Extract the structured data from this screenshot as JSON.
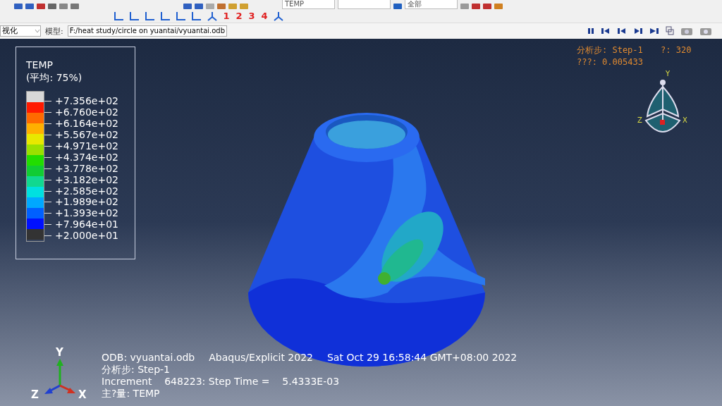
{
  "toolbar_top": {
    "fields": [
      "TEMP",
      "全部"
    ]
  },
  "view_toolbar": {
    "numbers": [
      "1",
      "2",
      "3",
      "4"
    ]
  },
  "context_bar": {
    "module": "视化",
    "model_label": "模型:",
    "model_path": "F:/heat study/circle on yuantai/vyuantai.odb"
  },
  "legend": {
    "title": "TEMP",
    "subtitle": "(平均: 75%)",
    "bands": [
      {
        "color": "#d8d8d8"
      },
      {
        "color": "#ff1a00"
      },
      {
        "color": "#ff6a00"
      },
      {
        "color": "#ffb000"
      },
      {
        "color": "#e8e800"
      },
      {
        "color": "#9ae000"
      },
      {
        "color": "#22dd00"
      },
      {
        "color": "#11cc33"
      },
      {
        "color": "#11d890"
      },
      {
        "color": "#00e0e0"
      },
      {
        "color": "#00a8ff"
      },
      {
        "color": "#0060ff"
      },
      {
        "color": "#0010ff"
      },
      {
        "color": "#333333"
      }
    ],
    "ticks": [
      "+7.356e+02",
      "+6.760e+02",
      "+6.164e+02",
      "+5.567e+02",
      "+4.971e+02",
      "+4.374e+02",
      "+3.778e+02",
      "+3.182e+02",
      "+2.585e+02",
      "+1.989e+02",
      "+1.393e+02",
      "+7.964e+01",
      "+2.000e+01"
    ]
  },
  "step_info": {
    "line_1": "分析步: Step-1",
    "line_1_extra": "?: 320",
    "line_2": "???: 0.005433"
  },
  "triad_top": {
    "y": "Y",
    "z": "Z",
    "x": "X"
  },
  "triad_bottom": {
    "y": "Y",
    "z": "Z",
    "x": "X"
  },
  "info": {
    "odb": "ODB: vyuantai.odb",
    "solver": "Abaqus/Explicit 2022",
    "date": "Sat Oct 29 16:58:44 GMT+08:00 2022",
    "step": "分析步: Step-1",
    "increment": "Increment    648223: Step Time =    5.4333E-03",
    "variable": "主?量: TEMP"
  }
}
